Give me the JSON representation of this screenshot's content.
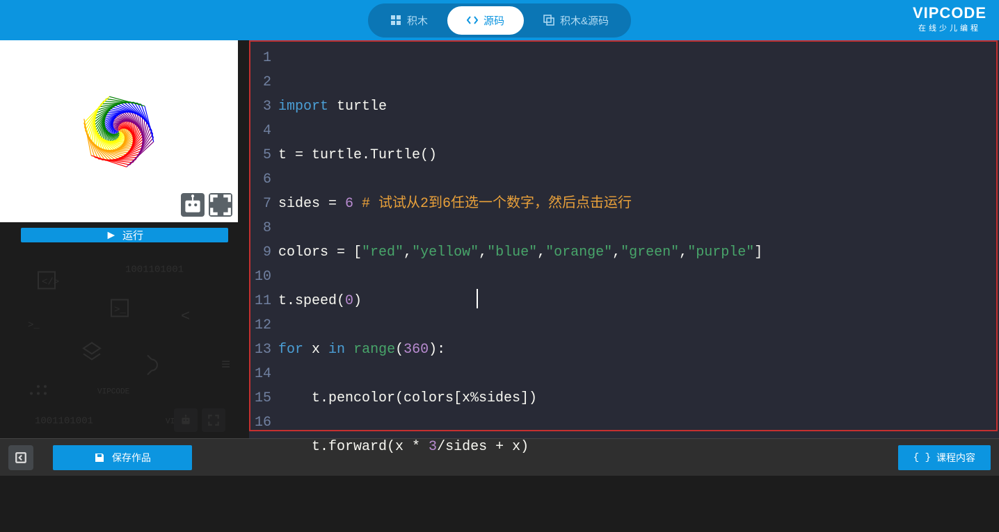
{
  "topbar": {
    "tabs": {
      "blocks": "积木",
      "source": "源码",
      "both": "积木&源码"
    }
  },
  "brand": {
    "logo": "VIPCODE",
    "tagline": "在线少儿编程"
  },
  "run_button": "运行",
  "bottom": {
    "save": "保存作品",
    "course": "课程内容"
  },
  "code": {
    "lines": [
      {
        "n": "1",
        "tokens": [
          [
            "kw",
            "import"
          ],
          [
            "",
            " turtle"
          ]
        ]
      },
      {
        "n": "2",
        "tokens": []
      },
      {
        "n": "3",
        "tokens": [
          [
            "",
            "t = turtle.Turtle()"
          ]
        ]
      },
      {
        "n": "4",
        "tokens": []
      },
      {
        "n": "5",
        "tokens": [
          [
            "",
            "sides = "
          ],
          [
            "nm",
            "6"
          ],
          [
            "",
            " "
          ],
          [
            "cm",
            "# 试试从2到6任选一个数字，然后点击运行"
          ]
        ]
      },
      {
        "n": "6",
        "tokens": []
      },
      {
        "n": "7",
        "tokens": [
          [
            "",
            "colors = ["
          ],
          [
            "st",
            "\"red\""
          ],
          [
            "",
            ","
          ],
          [
            "st",
            "\"yellow\""
          ],
          [
            "",
            ","
          ],
          [
            "st",
            "\"blue\""
          ],
          [
            "",
            ","
          ],
          [
            "st",
            "\"orange\""
          ],
          [
            "",
            ","
          ],
          [
            "st",
            "\"green\""
          ],
          [
            "",
            ","
          ],
          [
            "st",
            "\"purple\""
          ],
          [
            "",
            "]"
          ]
        ]
      },
      {
        "n": "8",
        "tokens": []
      },
      {
        "n": "9",
        "tokens": [
          [
            "",
            "t.speed("
          ],
          [
            "nm",
            "0"
          ],
          [
            "",
            ")"
          ]
        ]
      },
      {
        "n": "10",
        "tokens": []
      },
      {
        "n": "11",
        "tokens": [
          [
            "kw",
            "for"
          ],
          [
            "",
            " x "
          ],
          [
            "kw",
            "in"
          ],
          [
            "",
            " "
          ],
          [
            "fn",
            "range"
          ],
          [
            "",
            "("
          ],
          [
            "nm",
            "360"
          ],
          [
            "",
            "):"
          ]
        ]
      },
      {
        "n": "12",
        "tokens": []
      },
      {
        "n": "13",
        "tokens": [
          [
            "",
            "    t.pencolor(colors[x%sides])"
          ]
        ]
      },
      {
        "n": "14",
        "tokens": []
      },
      {
        "n": "15",
        "tokens": [
          [
            "",
            "    t.forward(x * "
          ],
          [
            "nm",
            "3"
          ],
          [
            "",
            "/sides + x)"
          ]
        ]
      },
      {
        "n": "16",
        "tokens": []
      }
    ]
  },
  "icons": {
    "blocks": "blocks-icon",
    "code": "code-icon",
    "both": "layers-icon",
    "play": "play-icon",
    "robot": "robot-icon",
    "fullscreen": "fullscreen-icon",
    "collapse": "collapse-icon",
    "save": "save-icon",
    "braces": "braces-icon"
  }
}
